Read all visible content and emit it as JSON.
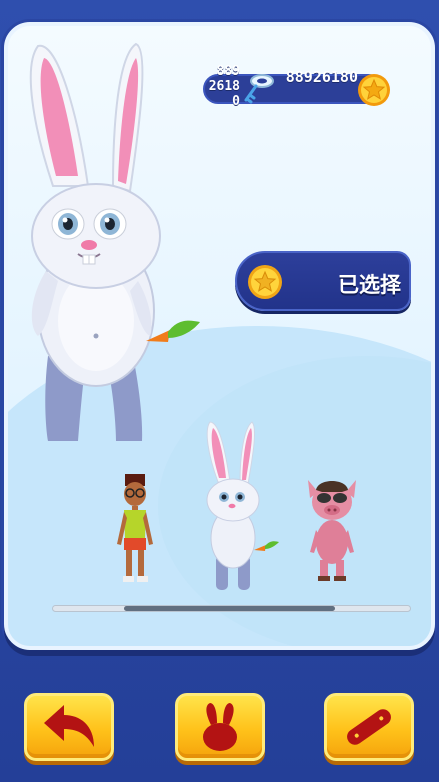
{
  "currency": {
    "keys": "889\n2618\n0",
    "coins": "88926180",
    "key_icon": "key-icon",
    "coin_icon": "coin-icon"
  },
  "selection": {
    "label": "已选择",
    "icon": "coin-icon"
  },
  "characters": [
    {
      "name": "bunny",
      "state": "featured"
    },
    {
      "name": "boy",
      "state": "option"
    },
    {
      "name": "bunny",
      "state": "option-selected"
    },
    {
      "name": "pig",
      "state": "option"
    }
  ],
  "scroll": {
    "start": 0.2,
    "end": 0.79
  },
  "buttons": [
    {
      "icon": "back-arrow-icon"
    },
    {
      "icon": "bunny-icon"
    },
    {
      "icon": "skateboard-icon"
    }
  ],
  "colors": {
    "panel": "#e6f4ff",
    "button": "#ffc21a",
    "icon_red": "#b31313",
    "bar": "#2c3f98"
  }
}
